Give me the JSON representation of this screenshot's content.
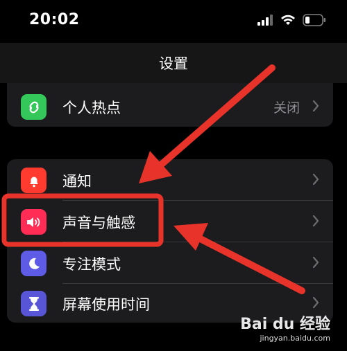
{
  "status_bar": {
    "time": "20:02"
  },
  "nav": {
    "title": "设置"
  },
  "rows": {
    "hotspot": {
      "label": "个人热点",
      "value": "关闭",
      "icon": "link-icon",
      "color": "#34c759"
    },
    "notifications": {
      "label": "通知",
      "icon": "bell-icon",
      "color": "#ff3b30"
    },
    "sounds": {
      "label": "声音与触感",
      "icon": "speaker-icon",
      "color": "#ff2d55"
    },
    "focus": {
      "label": "专注模式",
      "icon": "moon-icon",
      "color": "#5e5ce6"
    },
    "screen_time": {
      "label": "屏幕使用时间",
      "icon": "hourglass-icon",
      "color": "#5856d6"
    }
  },
  "watermark": {
    "brand": "Bai du 经验",
    "url": "jingyan.baidu.com"
  },
  "annotation_color": "#e8332a"
}
